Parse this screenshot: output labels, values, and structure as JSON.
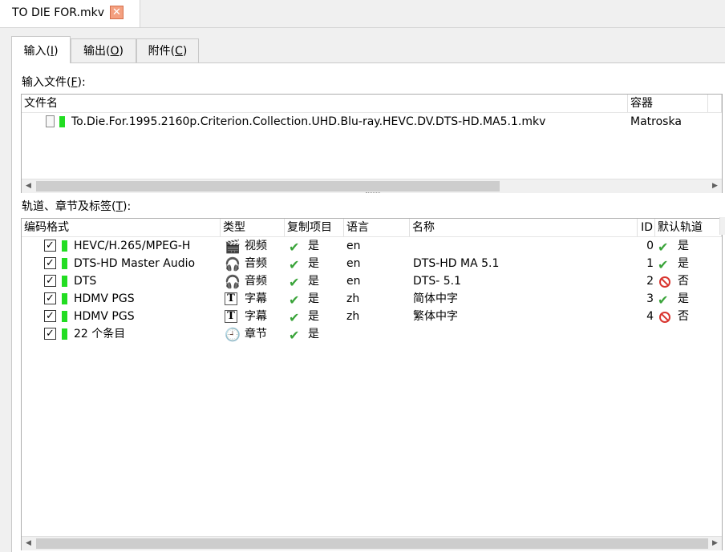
{
  "document_tab": {
    "title": "TO DIE FOR.mkv",
    "close_glyph": "✕"
  },
  "tabs": [
    {
      "label": "输入(",
      "key": "I",
      "suffix": ")"
    },
    {
      "label": "输出(",
      "key": "O",
      "suffix": ")"
    },
    {
      "label": "附件(",
      "key": "C",
      "suffix": ")"
    }
  ],
  "input_files": {
    "label": "输入文件(",
    "key": "F",
    "suffix": "):",
    "columns": {
      "filename": "文件名",
      "container": "容器"
    },
    "rows": [
      {
        "filename": "To.Die.For.1995.2160p.Criterion.Collection.UHD.Blu-ray.HEVC.DV.DTS-HD.MA5.1.mkv",
        "container": "Matroska"
      }
    ]
  },
  "tracks": {
    "label": "轨道、章节及标签(",
    "key": "T",
    "suffix": "):",
    "columns": {
      "codec": "编码格式",
      "type": "类型",
      "copy": "复制项目",
      "language": "语言",
      "name": "名称",
      "id": "ID",
      "default": "默认轨道"
    },
    "rows": [
      {
        "codec": "HEVC/H.265/MPEG-H",
        "type": "视频",
        "type_icon": "clapperboard-icon",
        "copy": "是",
        "language": "en",
        "name": "",
        "id": "0",
        "default": "是",
        "default_state": "yes"
      },
      {
        "codec": "DTS-HD Master Audio",
        "type": "音频",
        "type_icon": "headphones-icon",
        "copy": "是",
        "language": "en",
        "name": "DTS-HD MA 5.1",
        "id": "1",
        "default": "是",
        "default_state": "yes"
      },
      {
        "codec": "DTS",
        "type": "音频",
        "type_icon": "headphones-icon",
        "copy": "是",
        "language": "en",
        "name": "DTS- 5.1",
        "id": "2",
        "default": "否",
        "default_state": "no"
      },
      {
        "codec": "HDMV PGS",
        "type": "字幕",
        "type_icon": "subtitle-icon",
        "copy": "是",
        "language": "zh",
        "name": "简体中字",
        "id": "3",
        "default": "是",
        "default_state": "yes"
      },
      {
        "codec": "HDMV PGS",
        "type": "字幕",
        "type_icon": "subtitle-icon",
        "copy": "是",
        "language": "zh",
        "name": "繁体中字",
        "id": "4",
        "default": "否",
        "default_state": "no"
      },
      {
        "codec": "22 个条目",
        "type": "章节",
        "type_icon": "clock-icon",
        "copy": "是",
        "language": "",
        "name": "",
        "id": "",
        "default": "",
        "default_state": "none"
      }
    ]
  },
  "colors": {
    "active_track": "#22dd22",
    "check_green": "#3aa43a",
    "no_red": "#d9352f",
    "close_orange": "#f4a080"
  }
}
